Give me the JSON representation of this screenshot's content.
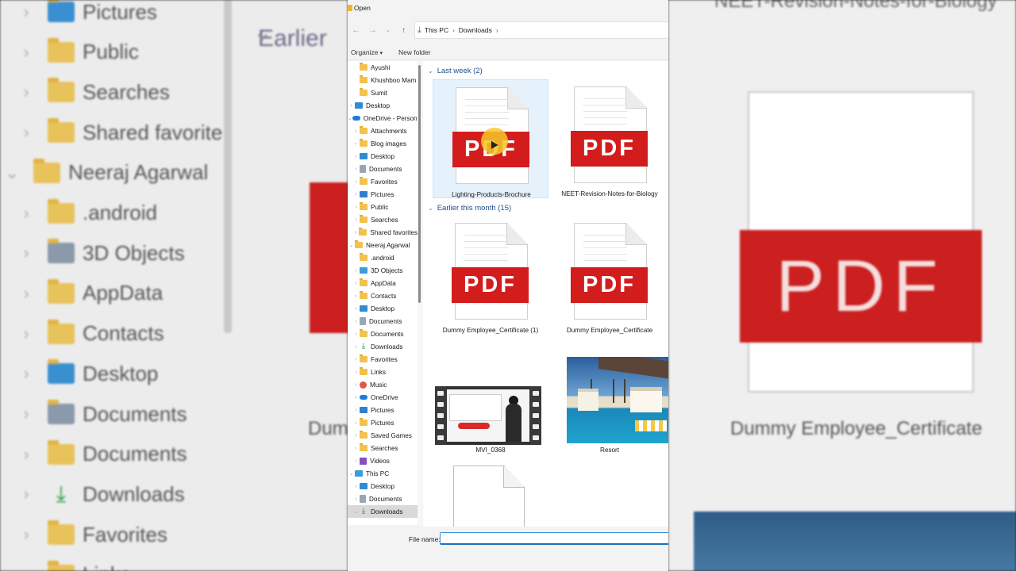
{
  "window": {
    "title": "Open"
  },
  "address": {
    "crumbs": [
      "This PC",
      "Downloads"
    ]
  },
  "toolbar": {
    "organize": "Organize",
    "new_folder": "New folder"
  },
  "nav_tree": [
    {
      "label": "Ayushi",
      "icon": "folder-icon",
      "indent": 2
    },
    {
      "label": "Khushboo Mam",
      "icon": "folder-icon",
      "indent": 2
    },
    {
      "label": "Sumit",
      "icon": "folder-icon",
      "indent": 2
    },
    {
      "label": "Desktop",
      "icon": "desktop-icon",
      "indent": 1,
      "chevron": "right"
    },
    {
      "label": "OneDrive - Personal",
      "icon": "cloud-icon",
      "indent": 1,
      "chevron": "down"
    },
    {
      "label": "Attachments",
      "icon": "folder-icon",
      "indent": 2,
      "chevron": "right"
    },
    {
      "label": "Blog images",
      "icon": "folder-icon",
      "indent": 2,
      "chevron": "right"
    },
    {
      "label": "Desktop",
      "icon": "desktop-icon",
      "indent": 2,
      "chevron": "right"
    },
    {
      "label": "Documents",
      "icon": "documents-icon",
      "indent": 2,
      "chevron": "right"
    },
    {
      "label": "Favorites",
      "icon": "folder-icon",
      "indent": 2,
      "chevron": "right"
    },
    {
      "label": "Pictures",
      "icon": "pictures-icon",
      "indent": 2,
      "chevron": "right"
    },
    {
      "label": "Public",
      "icon": "folder-icon",
      "indent": 2,
      "chevron": "right"
    },
    {
      "label": "Searches",
      "icon": "folder-icon",
      "indent": 2,
      "chevron": "right"
    },
    {
      "label": "Shared favorites",
      "icon": "folder-icon",
      "indent": 2,
      "chevron": "right"
    },
    {
      "label": "Neeraj Agarwal",
      "icon": "folder-icon",
      "indent": 1,
      "chevron": "down"
    },
    {
      "label": ".android",
      "icon": "folder-icon",
      "indent": 2
    },
    {
      "label": "3D Objects",
      "icon": "3d-objects-icon",
      "indent": 2,
      "chevron": "right"
    },
    {
      "label": "AppData",
      "icon": "folder-icon",
      "indent": 2,
      "chevron": "right"
    },
    {
      "label": "Contacts",
      "icon": "folder-icon",
      "indent": 2,
      "chevron": "right"
    },
    {
      "label": "Desktop",
      "icon": "desktop-icon",
      "indent": 2,
      "chevron": "right"
    },
    {
      "label": "Documents",
      "icon": "documents-icon",
      "indent": 2,
      "chevron": "right"
    },
    {
      "label": "Documents",
      "icon": "folder-icon",
      "indent": 2,
      "chevron": "right"
    },
    {
      "label": "Downloads",
      "icon": "downloads-icon",
      "indent": 2,
      "chevron": "right"
    },
    {
      "label": "Favorites",
      "icon": "folder-icon",
      "indent": 2,
      "chevron": "right"
    },
    {
      "label": "Links",
      "icon": "folder-icon",
      "indent": 2,
      "chevron": "right"
    },
    {
      "label": "Music",
      "icon": "music-icon",
      "indent": 2,
      "chevron": "right"
    },
    {
      "label": "OneDrive",
      "icon": "cloud-icon",
      "indent": 2,
      "chevron": "right"
    },
    {
      "label": "Pictures",
      "icon": "pictures-icon",
      "indent": 2,
      "chevron": "right"
    },
    {
      "label": "Pictures",
      "icon": "folder-icon",
      "indent": 2,
      "chevron": "right"
    },
    {
      "label": "Saved Games",
      "icon": "folder-icon",
      "indent": 2,
      "chevron": "right"
    },
    {
      "label": "Searches",
      "icon": "folder-icon",
      "indent": 2,
      "chevron": "right"
    },
    {
      "label": "Videos",
      "icon": "videos-icon",
      "indent": 2,
      "chevron": "right"
    },
    {
      "label": "This PC",
      "icon": "this-pc-icon",
      "indent": 1,
      "chevron": "down"
    },
    {
      "label": "Desktop",
      "icon": "desktop-icon",
      "indent": 2,
      "chevron": "right"
    },
    {
      "label": "Documents",
      "icon": "documents-icon",
      "indent": 2,
      "chevron": "right"
    },
    {
      "label": "Downloads",
      "icon": "downloads-icon",
      "indent": 2,
      "chevron": "down",
      "selected": true
    }
  ],
  "groups": {
    "last_week": "Last week (2)",
    "earlier_month": "Earlier this month (15)"
  },
  "files": {
    "f1": "Lighting-Products-Brochure",
    "f2": "NEET-Revision-Notes-for-Biology",
    "f3": "Dummy Employee_Certificate (1)",
    "f4": "Dummy Employee_Certificate",
    "f5": "MVI_0368",
    "f6": "Resort"
  },
  "pdf_badge": "PDF",
  "footer": {
    "file_name_label": "File name:",
    "file_name_value": ""
  },
  "background": {
    "left_group": "Earlier",
    "left_items": [
      "Pictures",
      "Public",
      "Searches",
      "Shared favorite",
      "Neeraj Agarwal",
      ".android",
      "3D Objects",
      "AppData",
      "Contacts",
      "Desktop",
      "Documents",
      "Documents",
      "Downloads",
      "Favorites",
      "Links"
    ],
    "right_title": "NEET-Revision-Notes-for-Biology",
    "right_caption": "Dummy Employee_Certificate",
    "left_caption": "Dummy"
  },
  "colors": {
    "pdf_red": "#d31c1c",
    "accent_blue": "#1e4e8c",
    "selection": "#e5f1fb"
  }
}
